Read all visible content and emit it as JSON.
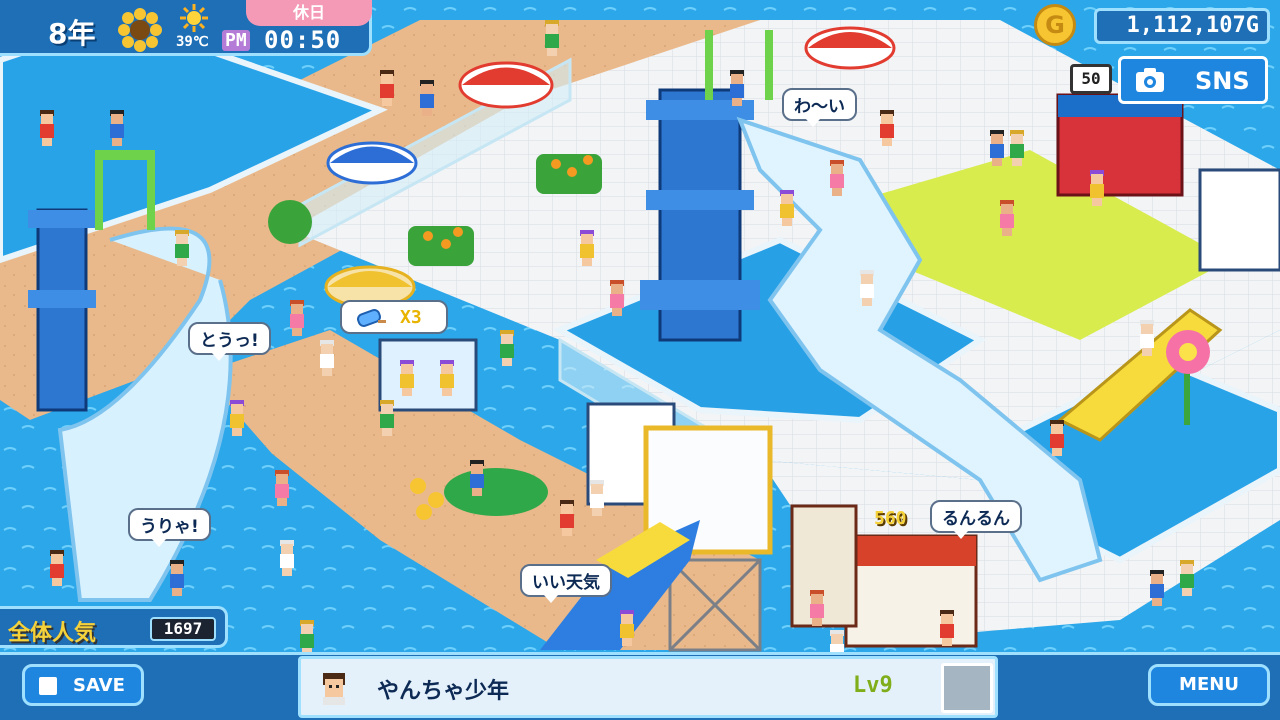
{
  "hud": {
    "year": "8年",
    "temperature": "39℃",
    "ampm": "PM",
    "time": "00:50",
    "day_status": "休日",
    "money": "1,112,107G",
    "coin_icon": "gold-coin-icon"
  },
  "sns": {
    "count": "50",
    "label": "SNS",
    "icon": "camera-icon"
  },
  "bubbles": {
    "b1": "わ〜い",
    "b2": "とうっ!",
    "b3": "うりゃ!",
    "b4": "いい天気",
    "b5": "るんるん",
    "item_multiplier": "X3"
  },
  "scores": {
    "pop1": "560"
  },
  "popularity": {
    "label": "全体人気",
    "value": "1697"
  },
  "footer": {
    "save_label": "SAVE",
    "menu_label": "MENU",
    "visitor_name": "やんちゃ少年",
    "visitor_level": "Lv9"
  },
  "colors": {
    "hud_blue": "#1e6fb6",
    "hud_border": "#9fe0ff",
    "pool_water": "#2aa6e8",
    "holiday_pink": "#f49ab6",
    "gold": "#f6d23a"
  }
}
